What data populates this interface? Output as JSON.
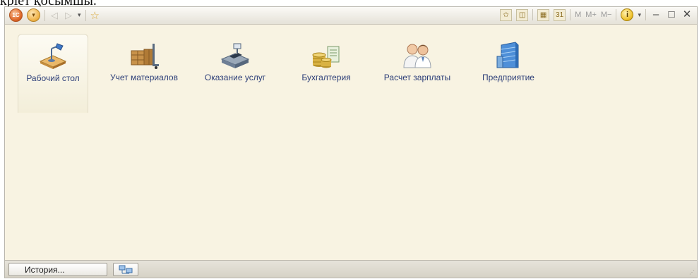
{
  "top_text": "кріет қосымшы.",
  "toolbar": {
    "logo_text": "1С",
    "menu_glyph": "▾",
    "back_glyph": "◁",
    "forward_glyph": "▷",
    "dropdown_glyph": "▾",
    "favorite_glyph": "☆",
    "add_favorite_glyph": "✩",
    "bookmarks_glyph": "◫",
    "calculator_glyph": "▦",
    "calendar_text": "31",
    "mem_labels": [
      "M",
      "M+",
      "M−"
    ],
    "info_text": "i",
    "info_dropdown_glyph": "▾",
    "minimize_glyph": "–",
    "maximize_glyph": "□",
    "close_glyph": "✕"
  },
  "sections": [
    {
      "label": "Рабочий стол",
      "icon": "desk-lamp-icon",
      "active": true
    },
    {
      "label": "Учет материалов",
      "icon": "warehouse-boxes-icon"
    },
    {
      "label": "Оказание услуг",
      "icon": "cash-register-icon"
    },
    {
      "label": "Бухгалтерия",
      "icon": "coins-ledger-icon"
    },
    {
      "label": "Расчет зарплаты",
      "icon": "employees-icon"
    },
    {
      "label": "Предприятие",
      "icon": "office-building-icon"
    }
  ],
  "status_bar": {
    "history_label": "История...",
    "network_icon": "network-connection-icon"
  },
  "colors": {
    "workspace_bg": "#f8f3e2",
    "section_label": "#2c3e78",
    "status_bar": "#dcd8cd"
  }
}
